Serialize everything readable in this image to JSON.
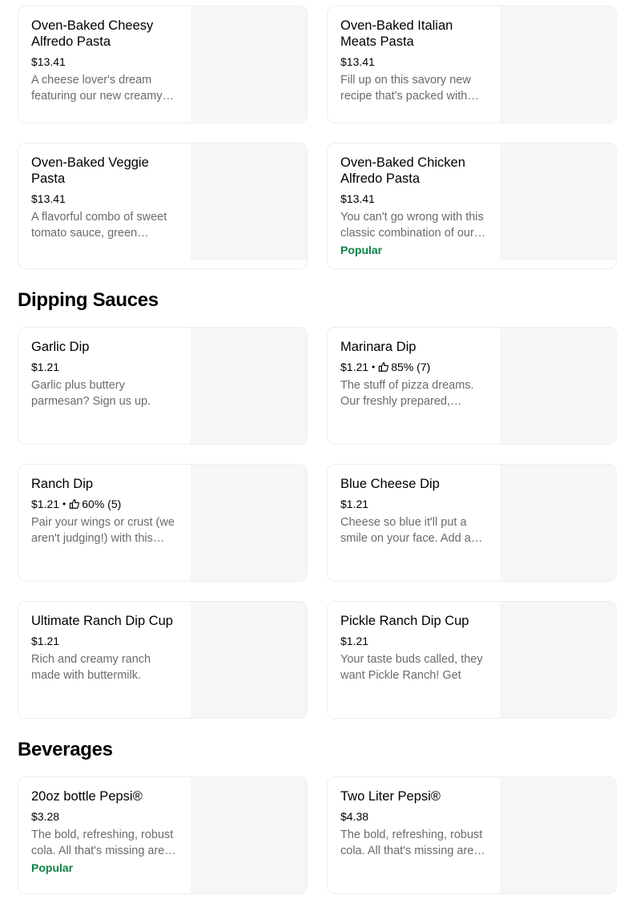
{
  "sections": [
    {
      "heading": "",
      "items": [
        {
          "title": "Oven-Baked Cheesy Alfredo Pasta",
          "price": "$13.41",
          "description": "A cheese lover's dream featuring our new creamy…"
        },
        {
          "title": "Oven-Baked Italian Meats Pasta",
          "price": "$13.41",
          "description": "Fill up on this savory new recipe that's packed with…"
        },
        {
          "title": "Oven-Baked Veggie Pasta",
          "price": "$13.41",
          "description": "A flavorful combo of sweet tomato sauce, green…"
        },
        {
          "title": "Oven-Baked Chicken Alfredo Pasta",
          "price": "$13.41",
          "description": "You can't go wrong with this classic combination of our…",
          "badge": "Popular"
        }
      ]
    },
    {
      "heading": "Dipping Sauces",
      "items": [
        {
          "title": "Garlic Dip",
          "price": "$1.21",
          "description": "Garlic plus buttery parmesan? Sign us up. Gre…"
        },
        {
          "title": "Marinara Dip",
          "price": "$1.21",
          "rating": "85% (7)",
          "description": "The stuff of pizza dreams. Our freshly prepared,…"
        },
        {
          "title": "Ranch Dip",
          "price": "$1.21",
          "rating": "60% (5)",
          "description": "Pair your wings or crust (we aren't judging!) with this…"
        },
        {
          "title": "Blue Cheese Dip",
          "price": "$1.21",
          "description": "Cheese so blue it'll put a smile on your face. Add a…"
        },
        {
          "title": "Ultimate Ranch Dip Cup",
          "price": "$1.21",
          "description": "Rich and creamy ranch made with buttermilk."
        },
        {
          "title": "Pickle Ranch Dip Cup",
          "price": "$1.21",
          "description": "Your taste buds called, they want Pickle Ranch! Get this…"
        }
      ]
    },
    {
      "heading": "Beverages",
      "items": [
        {
          "title": "20oz bottle Pepsi®",
          "price": "$3.28",
          "description": "The bold, refreshing, robust cola. All that's missing are…",
          "badge": "Popular"
        },
        {
          "title": "Two Liter Pepsi®",
          "price": "$4.38",
          "description": "The bold, refreshing, robust cola. All that's missing are…"
        }
      ]
    }
  ],
  "meta_separator": "•",
  "colors": {
    "popular": "#0e8345",
    "description": "#6b6b6b",
    "thumb_bg": "#f6f6f6",
    "card_border": "#eeeeee"
  },
  "icons": {
    "rating": "thumbs-up-icon"
  }
}
